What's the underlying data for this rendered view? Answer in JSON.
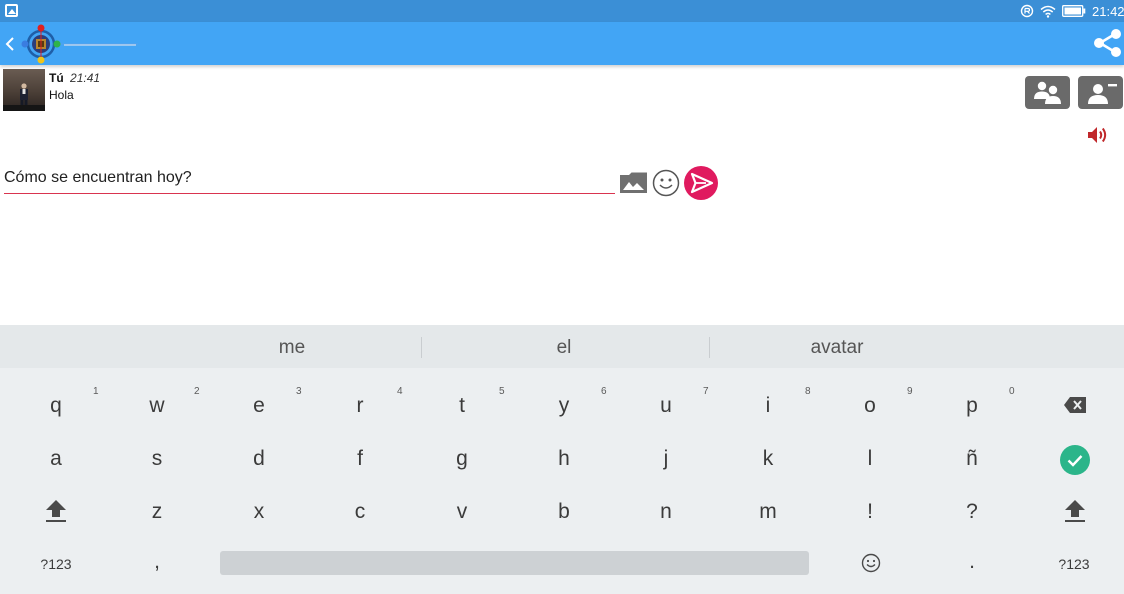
{
  "status_bar": {
    "time": "21:42",
    "icons": [
      "gallery-notification-icon",
      "sync-icon",
      "wifi-icon",
      "battery-icon"
    ]
  },
  "app_bar": {
    "icons": [
      "back-chevron-icon",
      "app-logo",
      "share-icon"
    ]
  },
  "message": {
    "sender": "Tú",
    "time": "21:41",
    "text": "Hola"
  },
  "actions": {
    "icons": [
      "group-icon",
      "remove-user-icon",
      "volume-icon"
    ]
  },
  "composer": {
    "value": "Cómo se encuentran hoy?",
    "icons": [
      "image-icon",
      "emoji-icon",
      "send-icon"
    ]
  },
  "keyboard": {
    "suggestions": [
      "me",
      "el",
      "avatar"
    ],
    "row1": [
      {
        "key": "q",
        "hint": "1"
      },
      {
        "key": "w",
        "hint": "2"
      },
      {
        "key": "e",
        "hint": "3"
      },
      {
        "key": "r",
        "hint": "4"
      },
      {
        "key": "t",
        "hint": "5"
      },
      {
        "key": "y",
        "hint": "6"
      },
      {
        "key": "u",
        "hint": "7"
      },
      {
        "key": "i",
        "hint": "8"
      },
      {
        "key": "o",
        "hint": "9"
      },
      {
        "key": "p",
        "hint": "0"
      }
    ],
    "row2": [
      "a",
      "s",
      "d",
      "f",
      "g",
      "h",
      "j",
      "k",
      "l",
      "ñ"
    ],
    "row3": [
      "z",
      "x",
      "c",
      "v",
      "b",
      "n",
      "m",
      "!",
      "?"
    ],
    "bottom": {
      "symbols_left": "?123",
      "comma": ",",
      "period": ".",
      "symbols_right": "?123"
    },
    "colors": {
      "accent_check": "#2bb58a",
      "send_button": "#e01a5f",
      "app_bar": "#42a5f5"
    }
  }
}
